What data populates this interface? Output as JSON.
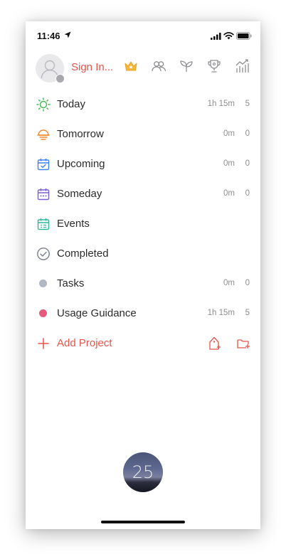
{
  "status_bar": {
    "time": "11:46"
  },
  "header": {
    "sign_in_label": "Sign In...",
    "icons": [
      "crown-icon",
      "group-icon",
      "sprout-icon",
      "trophy-icon",
      "statistics-icon"
    ]
  },
  "menu": [
    {
      "label": "Today",
      "duration": "1h 15m",
      "count": "5",
      "icon": "sun-icon",
      "color": "#3fb950"
    },
    {
      "label": "Tomorrow",
      "duration": "0m",
      "count": "0",
      "icon": "sunset-icon",
      "color": "#f08a2e"
    },
    {
      "label": "Upcoming",
      "duration": "0m",
      "count": "0",
      "icon": "calendar-check-icon",
      "color": "#3b82f6"
    },
    {
      "label": "Someday",
      "duration": "0m",
      "count": "0",
      "icon": "calendar-dots-icon",
      "color": "#7c5cd6"
    },
    {
      "label": "Events",
      "duration": "",
      "count": "",
      "icon": "calendar-list-icon",
      "color": "#2fb59a"
    },
    {
      "label": "Completed",
      "duration": "",
      "count": "",
      "icon": "check-circle-icon",
      "color": "#7a7f8c"
    },
    {
      "label": "Tasks",
      "duration": "0m",
      "count": "0",
      "icon": "dot",
      "color": "#b0b7c3"
    },
    {
      "label": "Usage Guidance",
      "duration": "1h 15m",
      "count": "5",
      "icon": "dot",
      "color": "#e85a7c"
    }
  ],
  "add_project": {
    "label": "Add Project",
    "color": "#e8534a"
  },
  "timer": {
    "value": "25"
  }
}
